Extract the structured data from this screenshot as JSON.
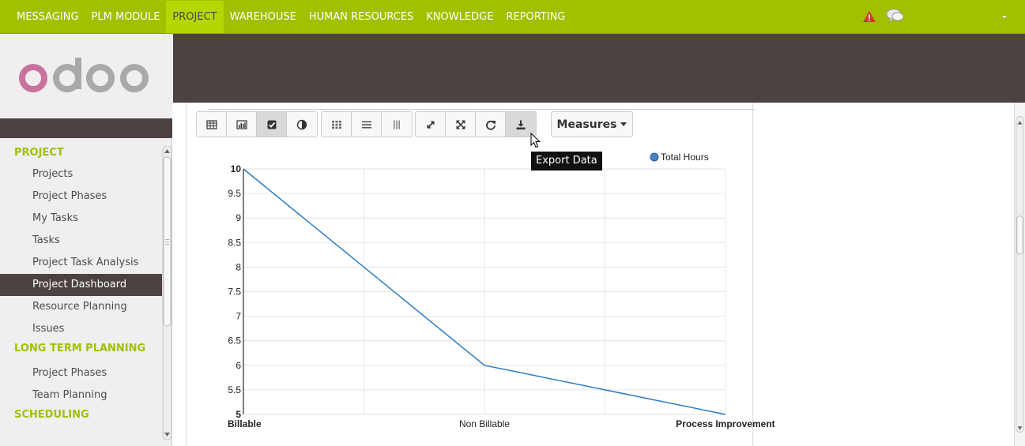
{
  "topbar": {
    "menu": [
      {
        "label": "MESSAGING",
        "active": false
      },
      {
        "label": "PLM MODULE",
        "active": false
      },
      {
        "label": "PROJECT",
        "active": true
      },
      {
        "label": "WAREHOUSE",
        "active": false
      },
      {
        "label": "HUMAN RESOURCES",
        "active": false
      },
      {
        "label": "KNOWLEDGE",
        "active": false
      },
      {
        "label": "REPORTING",
        "active": false
      }
    ],
    "icons": [
      "alert-icon",
      "chat-icon",
      "caret-down-icon"
    ]
  },
  "logo": {
    "text": "odoo",
    "colors": [
      "#c8739e",
      "#a9a9a9"
    ]
  },
  "sidebar": {
    "sections": [
      {
        "title": "PROJECT",
        "items": [
          {
            "label": "Projects",
            "active": false
          },
          {
            "label": "Project Phases",
            "active": false
          },
          {
            "label": "My Tasks",
            "active": false
          },
          {
            "label": "Tasks",
            "active": false
          },
          {
            "label": "Project Task Analysis",
            "active": false
          },
          {
            "label": "Project Dashboard",
            "active": true
          },
          {
            "label": "Resource Planning",
            "active": false
          },
          {
            "label": "Issues",
            "active": false
          }
        ]
      },
      {
        "title": "LONG TERM PLANNING",
        "items": [
          {
            "label": "Project Phases",
            "active": false
          },
          {
            "label": "Team Planning",
            "active": false
          }
        ]
      },
      {
        "title": "SCHEDULING",
        "items": []
      }
    ]
  },
  "toolbar": {
    "groups": [
      {
        "buttons": [
          {
            "name": "pivot-table-icon",
            "pressed": false
          },
          {
            "name": "bar-chart-icon",
            "pressed": false
          },
          {
            "name": "line-chart-icon",
            "pressed": true
          },
          {
            "name": "pie-chart-icon",
            "pressed": false
          }
        ]
      },
      {
        "buttons": [
          {
            "name": "grid-icon",
            "pressed": false
          },
          {
            "name": "rows-icon",
            "pressed": false
          },
          {
            "name": "columns-icon",
            "pressed": false
          }
        ]
      },
      {
        "buttons": [
          {
            "name": "expand-icon",
            "pressed": false
          },
          {
            "name": "fullscreen-icon",
            "pressed": false
          },
          {
            "name": "refresh-icon",
            "pressed": false
          },
          {
            "name": "download-icon",
            "pressed": true
          }
        ]
      }
    ],
    "measures_label": "Measures",
    "tooltip": "Export Data"
  },
  "colors": {
    "accent": "#a0c000",
    "dark": "#4c4242",
    "series": "#2b7bc0"
  },
  "chart_data": {
    "type": "line",
    "categories": [
      "Billable",
      "Non Billable",
      "Process Improvement"
    ],
    "series": [
      {
        "name": "Total Hours",
        "values": [
          10,
          6,
          5
        ]
      }
    ],
    "ylim": [
      5,
      10
    ],
    "yticks": [
      "5",
      "5.5",
      "6",
      "6.5",
      "7",
      "7.5",
      "8",
      "8.5",
      "9",
      "9.5",
      "10"
    ],
    "bold_ticks": [
      "5",
      "10"
    ],
    "bold_categories": [
      "Billable",
      "Process Improvement"
    ],
    "legend": "top-right",
    "grid": true
  }
}
